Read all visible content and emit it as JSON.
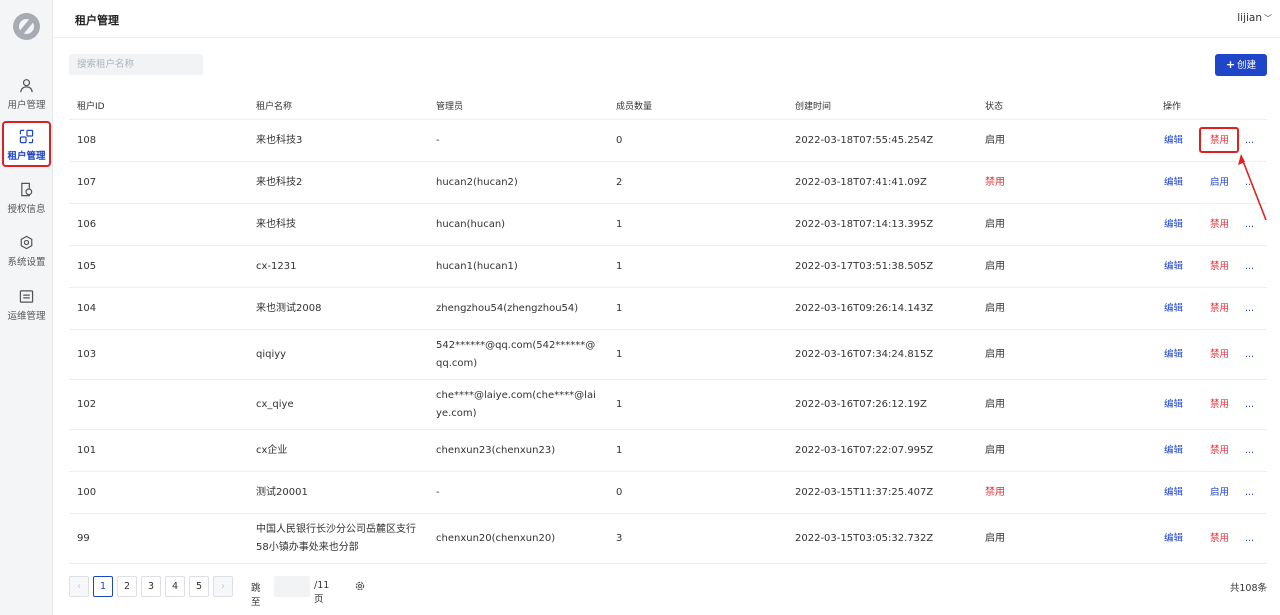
{
  "sidebar": {
    "items": [
      {
        "label": "用户管理",
        "icon": "user-icon"
      },
      {
        "label": "租户管理",
        "icon": "tenant-icon",
        "active": true
      },
      {
        "label": "授权信息",
        "icon": "license-icon"
      },
      {
        "label": "系统设置",
        "icon": "settings-icon"
      },
      {
        "label": "运维管理",
        "icon": "ops-icon"
      }
    ]
  },
  "header": {
    "title": "租户管理",
    "user": "lijian"
  },
  "toolbar": {
    "search_placeholder": "搜索租户名称",
    "create_label": "创建"
  },
  "table": {
    "columns": [
      "租户ID",
      "租户名称",
      "管理员",
      "成员数量",
      "创建时间",
      "状态",
      "操作"
    ],
    "rows": [
      {
        "id": "108",
        "name": "来也科技3",
        "admin": "-",
        "members": "0",
        "created": "2022-03-18T07:55:45.254Z",
        "status": "启用",
        "edit": "编辑",
        "toggle": "禁用",
        "more": "..."
      },
      {
        "id": "107",
        "name": "来也科技2",
        "admin": "hucan2(hucan2)",
        "members": "2",
        "created": "2022-03-18T07:41:41.09Z",
        "status": "禁用",
        "edit": "编辑",
        "toggle": "启用",
        "more": "..."
      },
      {
        "id": "106",
        "name": "来也科技",
        "admin": "hucan(hucan)",
        "members": "1",
        "created": "2022-03-18T07:14:13.395Z",
        "status": "启用",
        "edit": "编辑",
        "toggle": "禁用",
        "more": "..."
      },
      {
        "id": "105",
        "name": "cx-1231",
        "admin": "hucan1(hucan1)",
        "members": "1",
        "created": "2022-03-17T03:51:38.505Z",
        "status": "启用",
        "edit": "编辑",
        "toggle": "禁用",
        "more": "..."
      },
      {
        "id": "104",
        "name": "来也测试2008",
        "admin": "zhengzhou54(zhengzhou54)",
        "members": "1",
        "created": "2022-03-16T09:26:14.143Z",
        "status": "启用",
        "edit": "编辑",
        "toggle": "禁用",
        "more": "..."
      },
      {
        "id": "103",
        "name": "qiqiyy",
        "admin": "542******@qq.com(542******@qq.com)",
        "members": "1",
        "created": "2022-03-16T07:34:24.815Z",
        "status": "启用",
        "edit": "编辑",
        "toggle": "禁用",
        "more": "..."
      },
      {
        "id": "102",
        "name": "cx_qiye",
        "admin": "che****@laiye.com(che****@laiye.com)",
        "members": "1",
        "created": "2022-03-16T07:26:12.19Z",
        "status": "启用",
        "edit": "编辑",
        "toggle": "禁用",
        "more": "..."
      },
      {
        "id": "101",
        "name": "cx企业",
        "admin": "chenxun23(chenxun23)",
        "members": "1",
        "created": "2022-03-16T07:22:07.995Z",
        "status": "启用",
        "edit": "编辑",
        "toggle": "禁用",
        "more": "..."
      },
      {
        "id": "100",
        "name": "测试20001",
        "admin": "-",
        "members": "0",
        "created": "2022-03-15T11:37:25.407Z",
        "status": "禁用",
        "edit": "编辑",
        "toggle": "启用",
        "more": "..."
      },
      {
        "id": "99",
        "name": "中国人民银行长沙分公司岳麓区支行58小镇办事处来也分部",
        "admin": "chenxun20(chenxun20)",
        "members": "3",
        "created": "2022-03-15T03:05:32.732Z",
        "status": "启用",
        "edit": "编辑",
        "toggle": "禁用",
        "more": "..."
      }
    ]
  },
  "pagination": {
    "pages": [
      "1",
      "2",
      "3",
      "4",
      "5"
    ],
    "current": "1",
    "prev": "‹",
    "next": "›",
    "jump_label": "跳至",
    "total_pages": "/11页",
    "total": "共108条"
  },
  "colors": {
    "primary": "#1f45c9",
    "danger": "#e0343c",
    "highlight": "#e02020"
  }
}
